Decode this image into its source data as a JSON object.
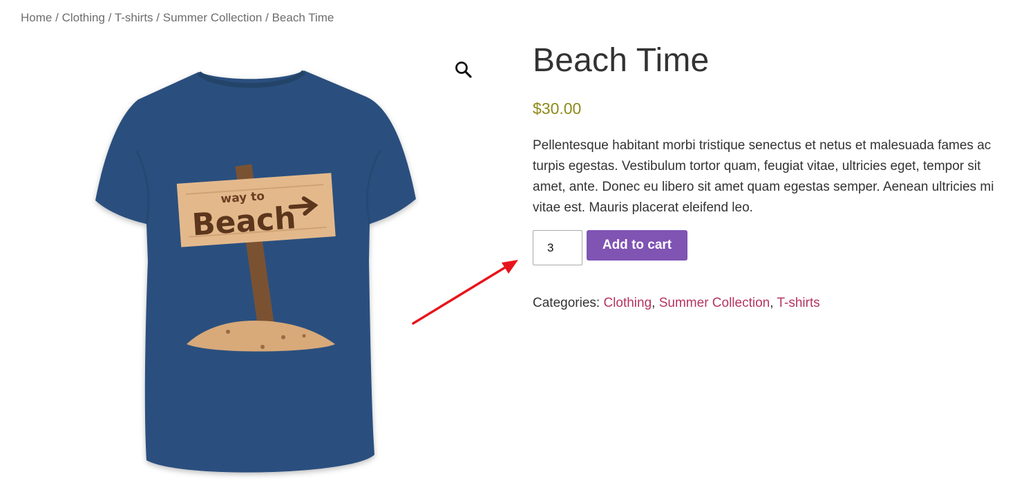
{
  "breadcrumb": {
    "items": [
      "Home",
      "Clothing",
      "T-shirts",
      "Summer Collection"
    ],
    "current": "Beach Time",
    "separator": "/"
  },
  "product": {
    "title": "Beach Time",
    "price": "$30.00",
    "description": "Pellentesque habitant morbi tristique senectus et netus et malesuada fames ac turpis egestas. Vestibulum tortor quam, feugiat vitae, ultricies eget, tempor sit amet, ante. Donec eu libero sit amet quam egestas semper. Aenean ultricies mi vitae est. Mauris placerat eleifend leo.",
    "quantity": "3",
    "add_to_cart_label": "Add to cart",
    "categories_label": "Categories:",
    "categories": [
      "Clothing",
      "Summer Collection",
      "T-shirts"
    ],
    "category_separator": ","
  },
  "image": {
    "sign_line1": "way to",
    "sign_line2": "Beach",
    "shirt_color": "#2c4f7e",
    "sign_color": "#e3b98c"
  },
  "icons": {
    "zoom": "magnifier-icon",
    "annotation": "red-arrow-icon"
  },
  "colors": {
    "button": "#7f54b3",
    "price": "#8f8a1a",
    "link": "#b6345e",
    "annotation": "#e8141c"
  }
}
